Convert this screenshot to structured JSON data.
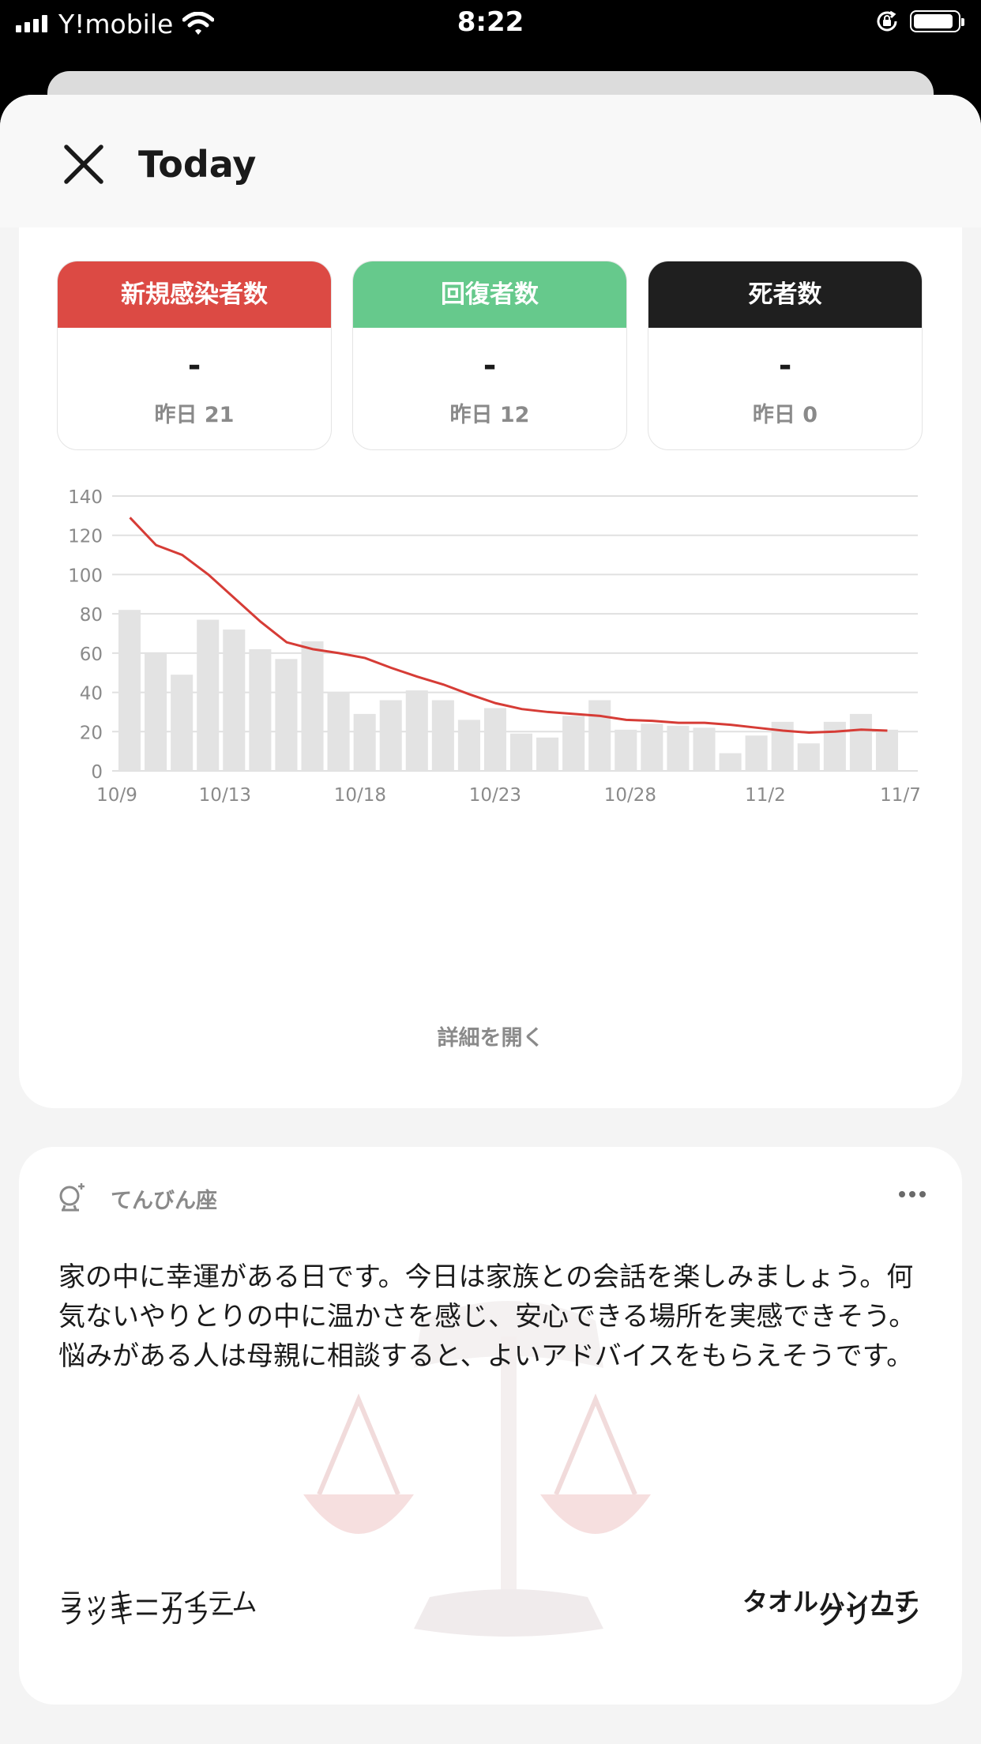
{
  "status_bar": {
    "carrier": "Y!mobile",
    "time": "8:22",
    "signal_bars": 4,
    "battery_level": 0.9
  },
  "header": {
    "title": "Today"
  },
  "stats": [
    {
      "label": "新規感染者数",
      "value": "-",
      "prev": "昨日 21",
      "color": "#dc4a44"
    },
    {
      "label": "回復者数",
      "value": "-",
      "prev": "昨日 12",
      "color": "#66c98c"
    },
    {
      "label": "死者数",
      "value": "-",
      "prev": "昨日 0",
      "color": "#1f1f1f"
    }
  ],
  "chart_data": {
    "type": "bar",
    "x_tick_labels": [
      "10/9",
      "10/13",
      "10/18",
      "10/23",
      "10/28",
      "11/2",
      "11/7"
    ],
    "x_dates": [
      "10/9",
      "10/10",
      "10/11",
      "10/12",
      "10/13",
      "10/14",
      "10/15",
      "10/16",
      "10/17",
      "10/18",
      "10/19",
      "10/20",
      "10/21",
      "10/22",
      "10/23",
      "10/24",
      "10/25",
      "10/26",
      "10/27",
      "10/28",
      "10/29",
      "10/30",
      "10/31",
      "11/1",
      "11/2",
      "11/3",
      "11/4",
      "11/5",
      "11/6",
      "11/7"
    ],
    "series": [
      {
        "values": [
          82,
          60,
          49,
          77,
          72,
          62,
          57,
          66,
          40,
          29,
          36,
          41,
          36,
          26,
          32,
          19,
          17,
          28,
          36,
          21,
          24,
          23,
          22,
          9,
          18,
          25,
          14,
          25,
          29,
          21
        ],
        "color": "#e3e3e3"
      },
      {
        "type": "line",
        "values": [
          129,
          115,
          110,
          100,
          88,
          76,
          65.5,
          62,
          60,
          57.5,
          52.5,
          48,
          44,
          39,
          34.5,
          31.5,
          30,
          29,
          28,
          26,
          25.5,
          24.5,
          24.5,
          23.5,
          22,
          20.5,
          19.5,
          20,
          21,
          20.5
        ],
        "color": "#d63c36"
      }
    ],
    "ylim": [
      0,
      140
    ],
    "y_ticks": [
      0,
      20,
      40,
      60,
      80,
      100,
      120,
      140
    ],
    "grid": true
  },
  "details_label": "詳細を開く",
  "horoscope": {
    "sign": "てんびん座",
    "text": "家の中に幸運がある日です。今日は家族との会話を楽しみましょう。何気ないやりとりの中に温かさを感じ、安心できる場所を実感できそう。悩みがある人は母親に相談すると、よいアドバイスをもらえそうです。",
    "lucky_color_label": "ラッキーカラー",
    "lucky_color_value": "グリーン",
    "lucky_item_label": "ラッキーアイテム",
    "lucky_item_value": "タオルハンカチ"
  },
  "icons": [
    "close-icon",
    "horoscope-icon",
    "more-icon",
    "wifi-icon",
    "orientation-lock-icon",
    "battery-icon"
  ]
}
